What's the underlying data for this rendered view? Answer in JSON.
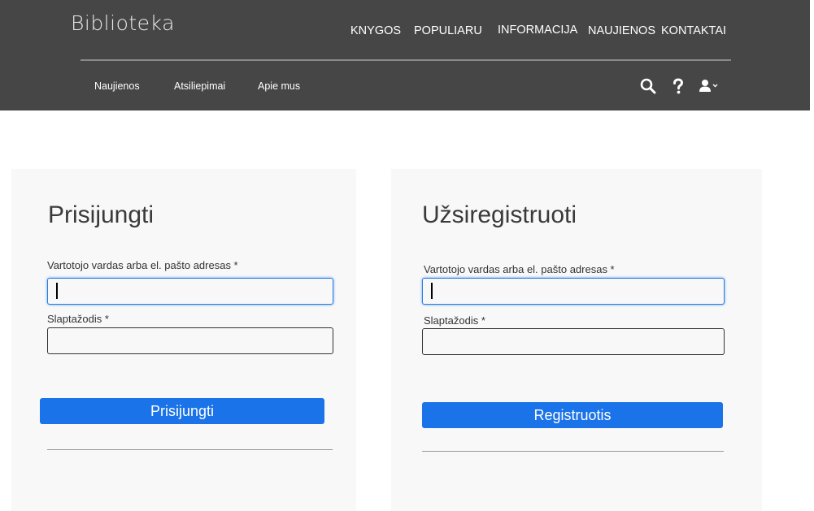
{
  "header": {
    "logo": "Biblioteka",
    "main_nav": [
      "KNYGOS",
      "POPULIARU",
      "INFORMACIJA",
      "NAUJIENOS",
      "KONTAKTAI"
    ],
    "sub_nav": [
      "Naujienos",
      "Atsiliepimai",
      "Apie mus"
    ],
    "icons": [
      "search-icon",
      "help-icon",
      "user-icon"
    ]
  },
  "login": {
    "title": "Prisijungti",
    "username_label": "Vartotojo vardas arba el. pašto adresas *",
    "username_value": "",
    "password_label": "Slaptažodis *",
    "password_value": "",
    "submit_label": "Prisijungti"
  },
  "register": {
    "title": "Užsiregistruoti",
    "username_label": "Vartotojo vardas arba el. pašto adresas *",
    "username_value": "",
    "password_label": "Slaptažodis *",
    "password_value": "",
    "submit_label": "Registruotis"
  },
  "colors": {
    "header_bg": "#464646",
    "button_bg": "#1a73e8",
    "card_bg": "#f8f8f8",
    "focus_border": "#2a7de1"
  }
}
